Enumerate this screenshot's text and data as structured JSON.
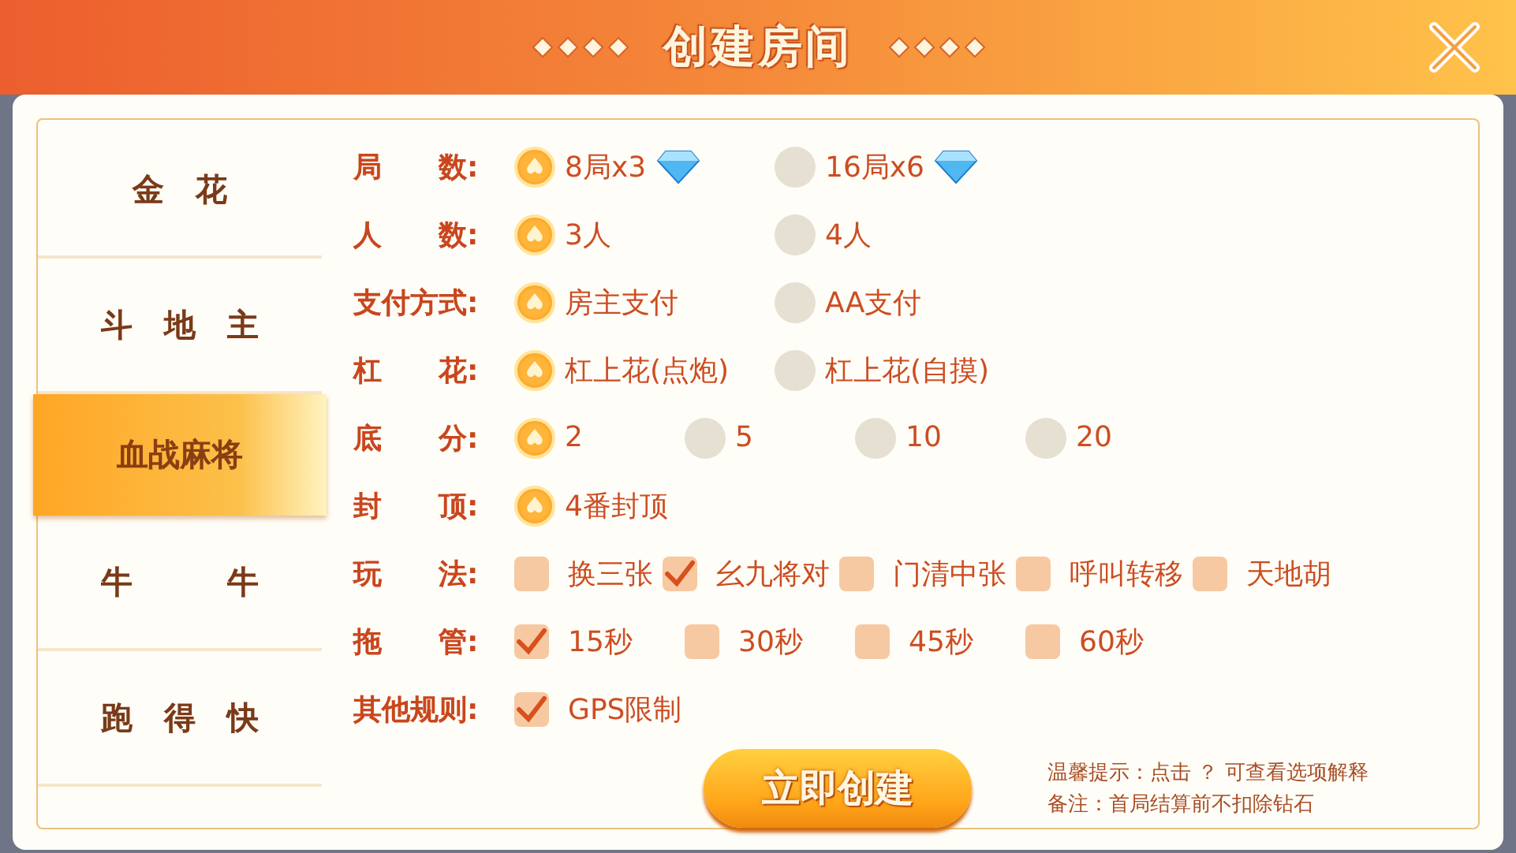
{
  "header": {
    "title": "创建房间"
  },
  "sidebar": {
    "items": [
      {
        "label": "金　花",
        "selected": false
      },
      {
        "label": "斗　地　主",
        "selected": false
      },
      {
        "label": "血战麻将",
        "selected": true
      },
      {
        "label": "牛　　　牛",
        "selected": false
      },
      {
        "label": "跑　得　快",
        "selected": false
      }
    ]
  },
  "rules": [
    {
      "label": "局　　数:",
      "kind": "radio",
      "options": [
        {
          "text": "8局x3",
          "selected": true,
          "gem": true
        },
        {
          "text": "16局x6",
          "selected": false,
          "gem": true
        }
      ]
    },
    {
      "label": "人　　数:",
      "kind": "radio",
      "options": [
        {
          "text": "3人",
          "selected": true
        },
        {
          "text": "4人",
          "selected": false
        }
      ]
    },
    {
      "label": "支付方式:",
      "kind": "radio",
      "options": [
        {
          "text": "房主支付",
          "selected": true
        },
        {
          "text": "AA支付",
          "selected": false
        }
      ]
    },
    {
      "label": "杠　　花:",
      "kind": "radio",
      "options": [
        {
          "text": "杠上花(点炮)",
          "selected": true
        },
        {
          "text": "杠上花(自摸)",
          "selected": false
        }
      ]
    },
    {
      "label": "底　　分:",
      "kind": "radio",
      "options": [
        {
          "text": "2",
          "selected": true
        },
        {
          "text": "5",
          "selected": false
        },
        {
          "text": "10",
          "selected": false
        },
        {
          "text": "20",
          "selected": false
        }
      ]
    },
    {
      "label": "封　　顶:",
      "kind": "radio",
      "options": [
        {
          "text": "4番封顶",
          "selected": true
        }
      ]
    },
    {
      "label": "玩　　法:",
      "kind": "check",
      "options": [
        {
          "text": "换三张",
          "checked": false
        },
        {
          "text": "幺九将对",
          "checked": true
        },
        {
          "text": "门清中张",
          "checked": false
        },
        {
          "text": "呼叫转移",
          "checked": false
        },
        {
          "text": "天地胡",
          "checked": false
        }
      ]
    },
    {
      "label": "拖　　管:",
      "kind": "check",
      "options": [
        {
          "text": "15秒",
          "checked": true
        },
        {
          "text": "30秒",
          "checked": false
        },
        {
          "text": "45秒",
          "checked": false
        },
        {
          "text": "60秒",
          "checked": false
        }
      ]
    },
    {
      "label": "其他规则:",
      "kind": "check",
      "options": [
        {
          "text": "GPS限制",
          "checked": true
        }
      ]
    }
  ],
  "create_button": "立即创建",
  "notes": [
    "温馨提示：点击 ？ 可查看选项解释",
    "备注：首局结算前不扣除钻石"
  ]
}
